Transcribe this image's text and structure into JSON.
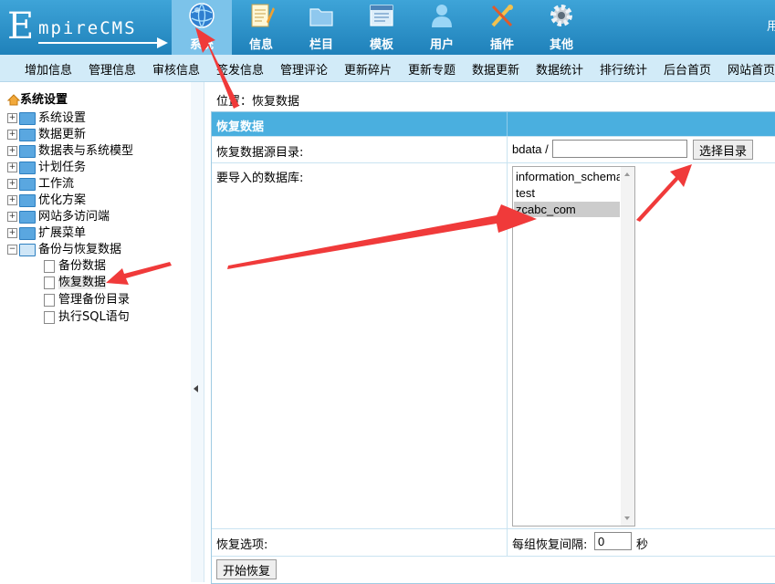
{
  "header": {
    "logo_initial": "E",
    "logo_text": "mpireCMS",
    "tabs": [
      {
        "label": "系统",
        "icon": "globe-icon",
        "active": true
      },
      {
        "label": "信息",
        "icon": "notepad-icon"
      },
      {
        "label": "栏目",
        "icon": "folder-icon"
      },
      {
        "label": "模板",
        "icon": "window-icon"
      },
      {
        "label": "用户",
        "icon": "user-icon"
      },
      {
        "label": "插件",
        "icon": "tools-icon"
      },
      {
        "label": "其他",
        "icon": "gear-icon"
      }
    ],
    "user_text": "用"
  },
  "submenu": [
    "增加信息",
    "管理信息",
    "审核信息",
    "签发信息",
    "管理评论",
    "更新碎片",
    "更新专题",
    "数据更新",
    "数据统计",
    "排行统计",
    "后台首页",
    "网站首页"
  ],
  "sidebar": {
    "root": "系统设置",
    "items": [
      "系统设置",
      "数据更新",
      "数据表与系统模型",
      "计划任务",
      "工作流",
      "优化方案",
      "网站多访问端",
      "扩展菜单",
      "备份与恢复数据"
    ],
    "children": [
      "备份数据",
      "恢复数据",
      "管理备份目录",
      "执行SQL语句"
    ],
    "selected_child": "恢复数据"
  },
  "main": {
    "location_label": "位置：",
    "location_value": "恢复数据",
    "header_title": "恢复数据",
    "source_dir_label": "恢复数据源目录:",
    "source_dir_prefix": "bdata /",
    "source_dir_value": "",
    "select_dir_button": "选择目录",
    "db_label": "要导入的数据库:",
    "databases": [
      "information_schema",
      "test",
      "zcabc_com"
    ],
    "selected_database": "zcabc_com",
    "options_label": "恢复选项:",
    "interval_label": "每组恢复间隔:",
    "interval_value": "0",
    "interval_unit": "秒",
    "start_button": "开始恢复"
  },
  "colors": {
    "header": "#2b8fc4",
    "submenu": "#d2ebf8",
    "table_header": "#4aafdf",
    "annotation_arrow": "#f03a3a"
  }
}
